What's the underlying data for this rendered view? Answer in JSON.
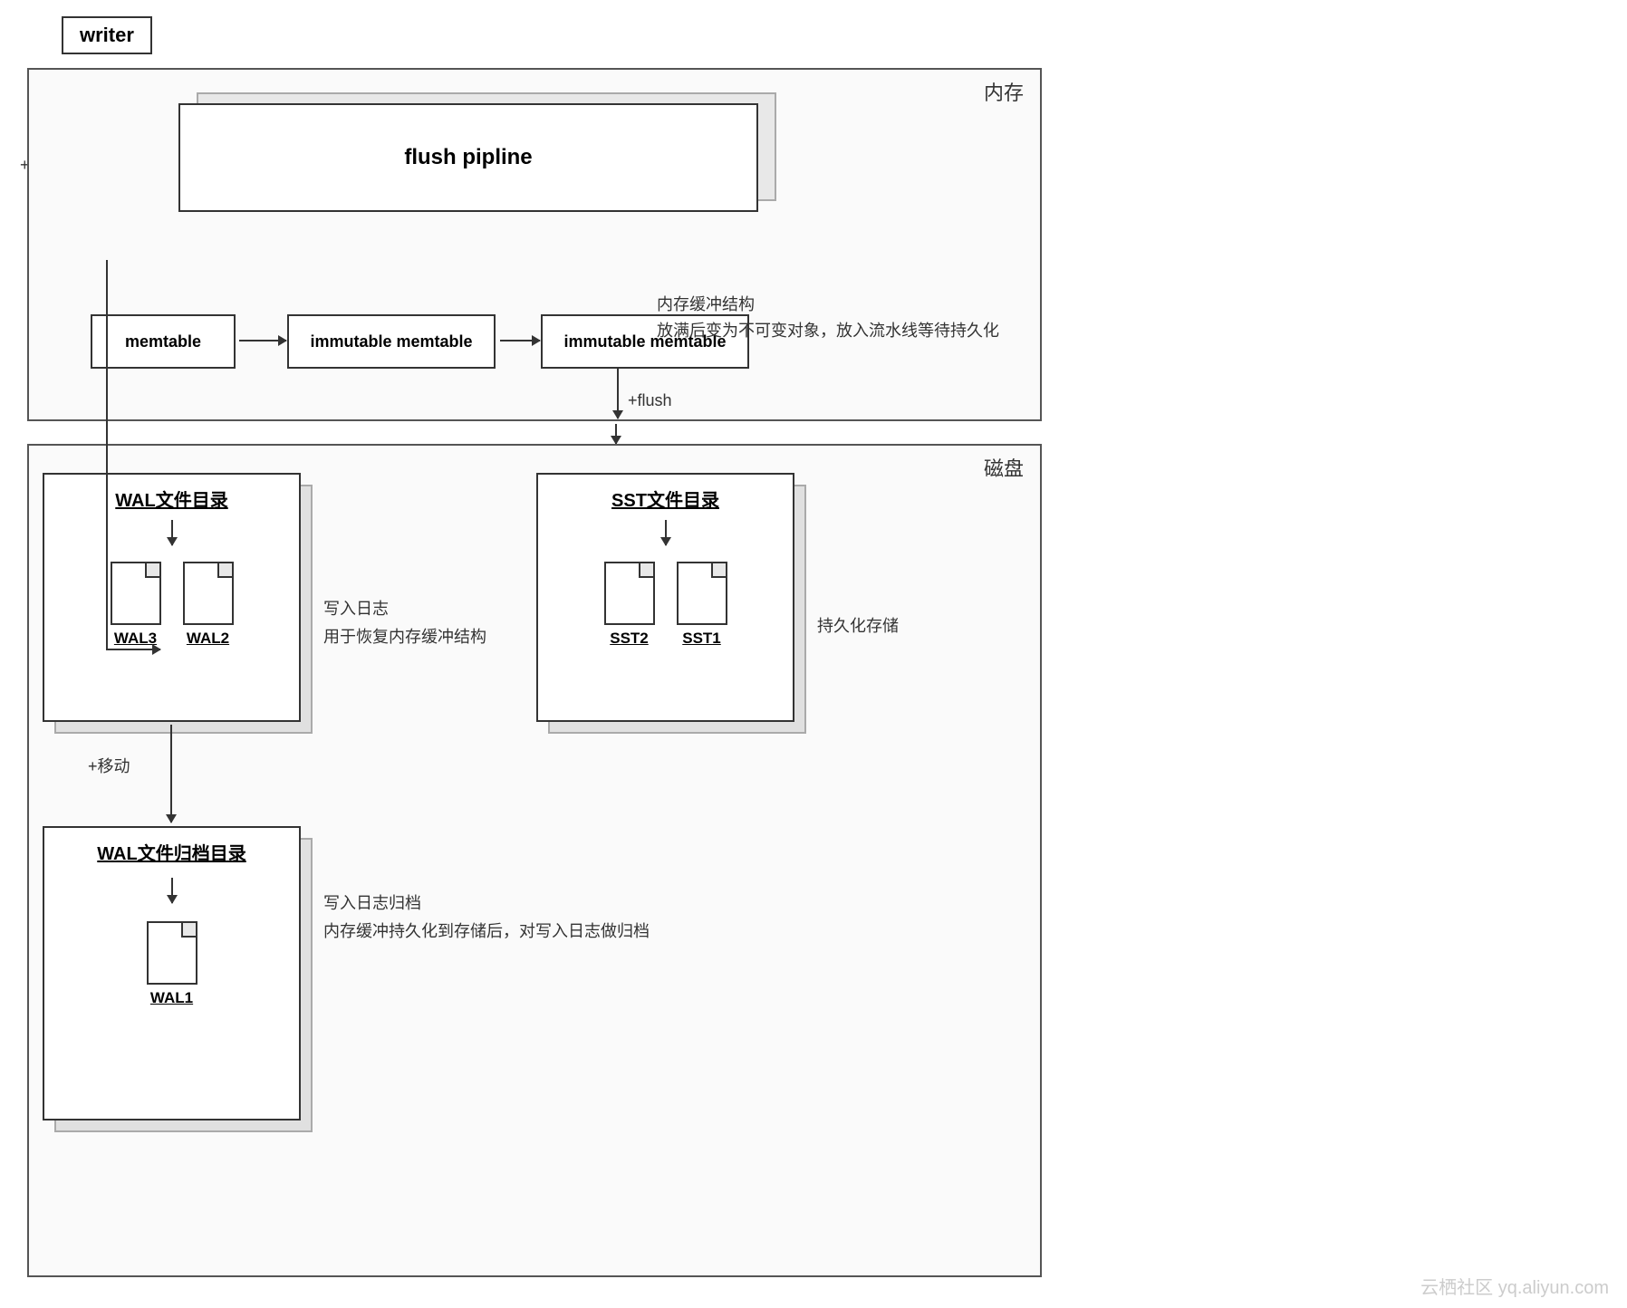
{
  "writer": {
    "label": "writer"
  },
  "regions": {
    "memory": "内存",
    "disk": "磁盘"
  },
  "flush_pipeline": {
    "label": "flush pipline"
  },
  "memtable": {
    "label": "memtable"
  },
  "immutable1": {
    "label": "immutable memtable"
  },
  "immutable2": {
    "label": "immutable memtable"
  },
  "memory_note": {
    "line1": "内存缓冲结构",
    "line2": "放满后变为不可变对象，放入流水线等待持久化"
  },
  "put_delete": {
    "label": "+put、delete"
  },
  "flush": {
    "label": "+flush"
  },
  "wal_dir": {
    "title": "WAL文件目录",
    "files": [
      {
        "label": "WAL3"
      },
      {
        "label": "WAL2"
      }
    ]
  },
  "sst_dir": {
    "title": "SST文件目录",
    "files": [
      {
        "label": "SST2"
      },
      {
        "label": "SST1"
      }
    ]
  },
  "wal_archive": {
    "title": "WAL文件归档目录",
    "files": [
      {
        "label": "WAL1"
      }
    ]
  },
  "wal_note": {
    "line1": "写入日志",
    "line2": "用于恢复内存缓冲结构"
  },
  "sst_note": {
    "label": "持久化存储"
  },
  "wal_arch_note": {
    "line1": "写入日志归档",
    "line2": "内存缓冲持久化到存储后，对写入日志做归档"
  },
  "move_label": "+移动",
  "watermark": "云栖社区 yq.aliyun.com"
}
